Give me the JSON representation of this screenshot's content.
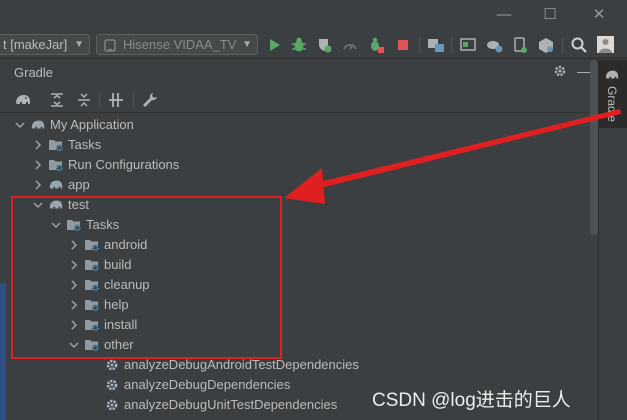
{
  "toolbar": {
    "run_config": "t [makeJar]",
    "device": "Hisense VIDAA_TV"
  },
  "panel": {
    "title": "Gradle",
    "side_tab": "Gradle"
  },
  "tree": {
    "my_application": "My Application",
    "tasks": "Tasks",
    "run_configurations": "Run Configurations",
    "app": "app",
    "test": "test",
    "test_tasks": "Tasks",
    "android": "android",
    "build": "build",
    "cleanup": "cleanup",
    "help": "help",
    "install": "install",
    "other": "other",
    "task1": "analyzeDebugAndroidTestDependencies",
    "task2": "analyzeDebugDependencies",
    "task3": "analyzeDebugUnitTestDependencies"
  },
  "watermark": "CSDN @log进击的巨人",
  "colors": {
    "annotation": "#e02020",
    "background": "#3c3f41",
    "run_green": "#59a869",
    "stop_red": "#e05555",
    "gradle_icon": "#9aa7b0"
  },
  "icons": [
    "minimize-icon",
    "maximize-icon",
    "close-icon",
    "run-icon",
    "debug-icon",
    "profile-icon",
    "stop-icon",
    "search-icon",
    "avatar",
    "elephant-icon",
    "folder-gear-icon",
    "gear-icon",
    "chevron-right-icon",
    "chevron-down-icon",
    "wrench-icon"
  ]
}
